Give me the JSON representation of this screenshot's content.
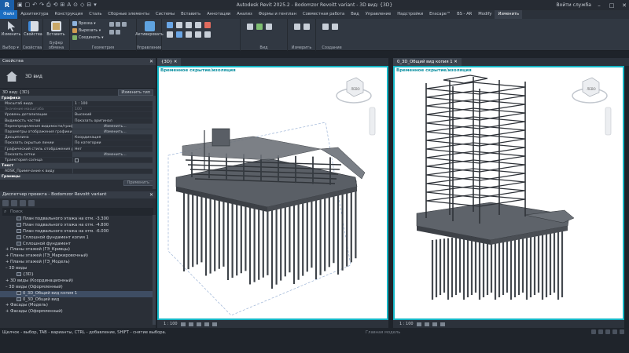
{
  "app": {
    "logo": "R",
    "title": "Autodesk Revit 2025.2 - Bodomzor Revoitt variant - 3D вид: {3D}",
    "user": "Войти служба",
    "window_controls": [
      "–",
      "□",
      "✕"
    ]
  },
  "quick_access": [
    "▣",
    "▢",
    "↶",
    "↷",
    "⎙",
    "⟲",
    "⊞",
    "A",
    "⊙",
    "◇",
    "⊟",
    "▾"
  ],
  "ribbon_tabs": [
    "Файл",
    "Архитектура",
    "Конструкция",
    "Сталь",
    "Сборные элементы",
    "Системы",
    "Вставить",
    "Аннотации",
    "Анализ",
    "Формы и генплан",
    "Совместная работа",
    "Вид",
    "Управление",
    "Надстройки",
    "Enscape™",
    "BS - AR",
    "Modify",
    "Изменить"
  ],
  "ribbon": {
    "groups": [
      {
        "label": "Выбор ▾"
      },
      {
        "label": "Свойства"
      },
      {
        "label": "Буфер обмена"
      },
      {
        "label": "Геометрия"
      },
      {
        "label": "Управление"
      },
      {
        "label": "Вид"
      },
      {
        "label": "Измерить"
      },
      {
        "label": "Создание"
      }
    ],
    "modify_btn": "Изменить",
    "properties_btn": "Свойства",
    "paste_btn": "Вставить",
    "geometry_rows": [
      "Врезка ▾",
      "Вырезать ▾",
      "Соединить ▾"
    ],
    "manage_btn": "Активировать"
  },
  "properties": {
    "header": "Свойства",
    "close_icon": "✕",
    "type_name": "3D вид",
    "instance_label": "3D вид: {3D}",
    "edit_type": "Изменить тип",
    "section_graphics": "Графика",
    "rows": [
      {
        "k": "Масштаб вида",
        "v": "1 : 100"
      },
      {
        "k": "Значение масштаба",
        "v": "100"
      },
      {
        "k": "Уровень детализации",
        "v": "Высокий"
      },
      {
        "k": "Видимость частей",
        "v": "Показать оригинал"
      },
      {
        "k": "Переопределения видимости/граф...",
        "v": "Изменить..."
      },
      {
        "k": "Параметры отображения графики",
        "v": "Изменить..."
      },
      {
        "k": "Дисциплина",
        "v": "Координация"
      },
      {
        "k": "Показать скрытые линии",
        "v": "По категории"
      },
      {
        "k": "Графический стиль отображения р...",
        "v": "Нет"
      },
      {
        "k": "Показать сетки",
        "v": "Изменить..."
      },
      {
        "k": "Траектория солнца",
        "v": ""
      }
    ],
    "section_text": "Текст",
    "text_rows": [
      {
        "k": "ADSK_Примечание к виду",
        "v": ""
      }
    ],
    "section_extents": "Границы",
    "apply_btn": "Применить"
  },
  "browser": {
    "header": "Диспетчер проекта - Bodomzor Revoitt variant",
    "close_icon": "✕",
    "search_placeholder": "Поиск",
    "items": [
      {
        "label": "План подвального этажа на отм. -3.300",
        "indent": 3,
        "icon": true
      },
      {
        "label": "План подвального этажа на отм. -4.800",
        "indent": 3,
        "icon": true
      },
      {
        "label": "План подвального этажа на отм. -6.000",
        "indent": 3,
        "icon": true
      },
      {
        "label": "Сплошной фундамент копия 1",
        "indent": 3,
        "icon": true
      },
      {
        "label": "Сплошной фундамент",
        "indent": 3,
        "icon": true
      },
      {
        "label": "+  Планы этажей (ГЭ_Кривцы)",
        "indent": 1,
        "icon": false
      },
      {
        "label": "+  Планы этажей (ГЭ_Маркировочный)",
        "indent": 1,
        "icon": false
      },
      {
        "label": "+  Планы этажей (ГЭ_Модель)",
        "indent": 1,
        "icon": false
      },
      {
        "label": "–  3D виды",
        "indent": 1,
        "icon": false
      },
      {
        "label": "{3D}",
        "indent": 3,
        "icon": true
      },
      {
        "label": "+  3D виды (Координационный)",
        "indent": 1,
        "icon": false
      },
      {
        "label": "–  3D виды (Оформленный)",
        "indent": 1,
        "icon": false
      },
      {
        "label": "0_3D_Общий вид копия 1",
        "indent": 3,
        "icon": true,
        "selected": true
      },
      {
        "label": "0_3D_Общий вид",
        "indent": 3,
        "icon": true
      },
      {
        "label": "+  Фасады (Модель)",
        "indent": 1,
        "icon": false
      },
      {
        "label": "+  Фасады (Оформленный)",
        "indent": 1,
        "icon": false
      }
    ]
  },
  "views": {
    "left_tab": "{3D}",
    "right_tab": "0_3D_Общий вид копия 1",
    "left_banner": "Временное скрытие/изоляция",
    "right_banner": "Временное скрытие/изоляция",
    "left_scale": "1 : 100",
    "right_scale": "1 : 100",
    "close_icon": "✕",
    "cube_label": "ЛЕВО"
  },
  "status": {
    "message": "Щелчок - выбор, TAB - варианты, CTRL - добавление, SHIFT - снятие выбора.",
    "model": "Главная модель",
    "zero": ":0"
  },
  "colors": {
    "accent": "#14b6c6",
    "file_tab": "#1b6ec2",
    "background": "#1e232a"
  }
}
